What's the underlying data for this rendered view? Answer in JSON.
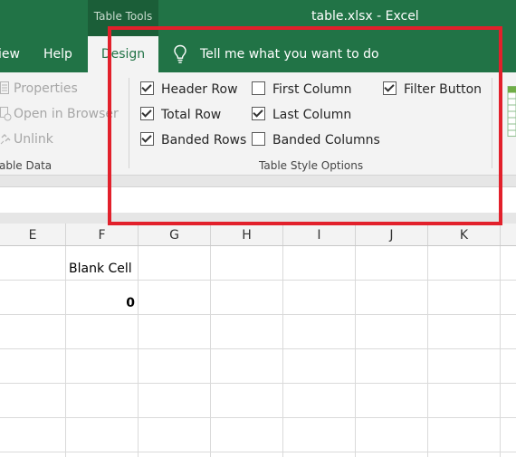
{
  "titlebar": {
    "contextual_group": "Table Tools",
    "window_title": "table.xlsx  -  Excel"
  },
  "tabs": {
    "partial_left": "iew",
    "help": "Help",
    "design": "Design",
    "tell_me": "Tell me what you want to do"
  },
  "ribbon": {
    "table_data": {
      "items": [
        "Properties",
        "Open in Browser",
        "Unlink"
      ],
      "label": "able Data"
    },
    "style_options": {
      "label": "Table Style Options",
      "options": [
        {
          "label": "Header Row",
          "checked": true
        },
        {
          "label": "Total Row",
          "checked": true
        },
        {
          "label": "Banded Rows",
          "checked": true
        },
        {
          "label": "First Column",
          "checked": false
        },
        {
          "label": "Last Column",
          "checked": true
        },
        {
          "label": "Banded Columns",
          "checked": false
        },
        {
          "label": "Filter Button",
          "checked": true
        }
      ]
    }
  },
  "grid": {
    "columns": [
      "E",
      "F",
      "G",
      "H",
      "I",
      "J",
      "K"
    ],
    "cells": {
      "f1": "Blank Cell",
      "f2": "0"
    }
  },
  "colors": {
    "accent": "#217346",
    "highlight": "#e2202b"
  }
}
